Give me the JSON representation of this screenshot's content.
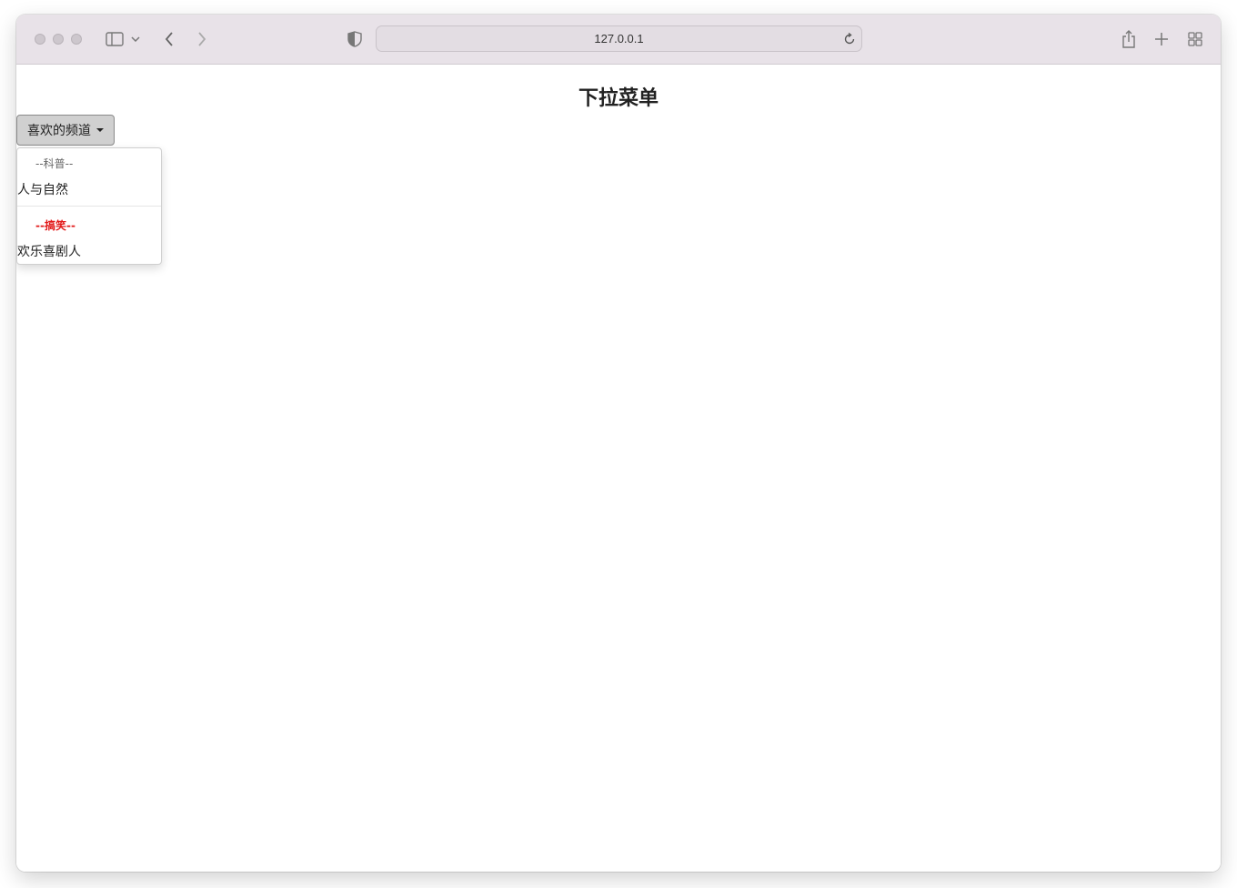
{
  "browser": {
    "url": "127.0.0.1",
    "icons": [
      "sidebar-icon",
      "chevron-down-icon",
      "back-icon",
      "forward-icon",
      "shield-icon",
      "reload-icon",
      "share-icon",
      "new-tab-icon",
      "tab-overview-icon"
    ]
  },
  "page": {
    "title": "下拉菜单",
    "dropdown": {
      "label": "喜欢的频道",
      "groups": [
        {
          "header": "--科普--",
          "header_color": "#666666",
          "items": [
            "人与自然"
          ]
        },
        {
          "header": "--搞笑--",
          "header_color": "#e21818",
          "items": [
            "欢乐喜剧人"
          ]
        }
      ]
    }
  }
}
